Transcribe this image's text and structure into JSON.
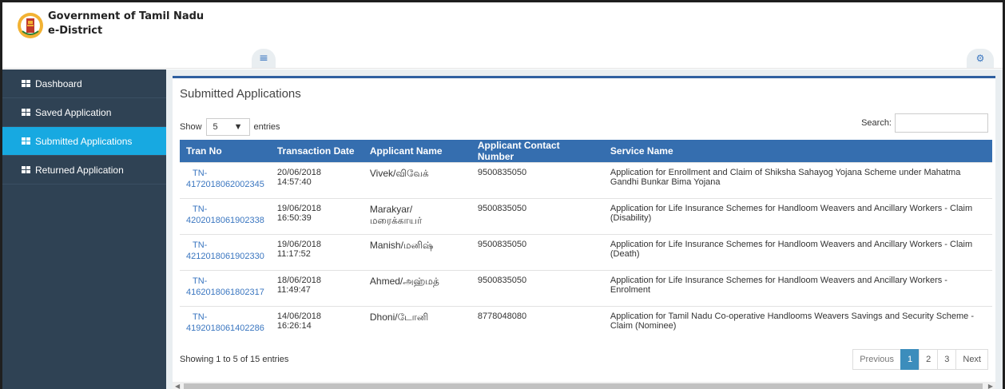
{
  "header": {
    "title": "Government of Tamil Nadu",
    "subtitle": "e-District"
  },
  "icons": {
    "menu": "hamburger-icon",
    "settings": "gears-icon",
    "sidebar": "grid-icon"
  },
  "colors": {
    "sidebar_bg": "#2f4254",
    "sidebar_active": "#17a9e1",
    "table_header": "#356eaf",
    "link": "#3a76c0"
  },
  "sidebar": {
    "items": [
      {
        "label": "Dashboard",
        "active": false
      },
      {
        "label": "Saved Application",
        "active": false
      },
      {
        "label": "Submitted Applications",
        "active": true
      },
      {
        "label": "Returned Application",
        "active": false
      }
    ]
  },
  "panel": {
    "title": "Submitted Applications",
    "show_label": "Show",
    "entries_value": "5",
    "entries_label": "entries",
    "search_label": "Search:",
    "search_value": ""
  },
  "table": {
    "headers": [
      "Tran No",
      "Transaction Date",
      "Applicant Name",
      "Applicant Contact Number",
      "Service Name"
    ],
    "rows": [
      {
        "tran_prefix": "TN-",
        "tran_num": "4172018062002345",
        "date": "20/06/2018 14:57:40",
        "name": "Vivek/விவேக்",
        "contact": "9500835050",
        "service": "Application for Enrollment and Claim of Shiksha Sahayog Yojana Scheme under Mahatma Gandhi Bunkar Bima Yojana"
      },
      {
        "tran_prefix": "TN-",
        "tran_num": "4202018061902338",
        "date": "19/06/2018 16:50:39",
        "name": "Marakyar/ மரைக்காயர்",
        "contact": "9500835050",
        "service": "Application for Life Insurance Schemes for Handloom Weavers and Ancillary Workers - Claim (Disability)"
      },
      {
        "tran_prefix": "TN-",
        "tran_num": "4212018061902330",
        "date": "19/06/2018 11:17:52",
        "name": "Manish/மனிஷ்",
        "contact": "9500835050",
        "service": "Application for Life Insurance Schemes for Handloom Weavers and Ancillary Workers - Claim (Death)"
      },
      {
        "tran_prefix": "TN-",
        "tran_num": "4162018061802317",
        "date": "18/06/2018 11:49:47",
        "name": "Ahmed/அஹ்மத்",
        "contact": "9500835050",
        "service": "Application for Life Insurance Schemes for Handloom Weavers and Ancillary Workers - Enrolment"
      },
      {
        "tran_prefix": "TN-",
        "tran_num": "4192018061402286",
        "date": "14/06/2018 16:26:14",
        "name": "Dhoni/டோனி",
        "contact": "8778048080",
        "service": "Application for Tamil Nadu Co-operative Handlooms Weavers Savings and Security Scheme - Claim (Nominee)"
      }
    ]
  },
  "footer": {
    "info": "Showing 1 to 5 of 15 entries",
    "previous": "Previous",
    "pages": [
      "1",
      "2",
      "3"
    ],
    "current_page": "1",
    "next": "Next"
  }
}
